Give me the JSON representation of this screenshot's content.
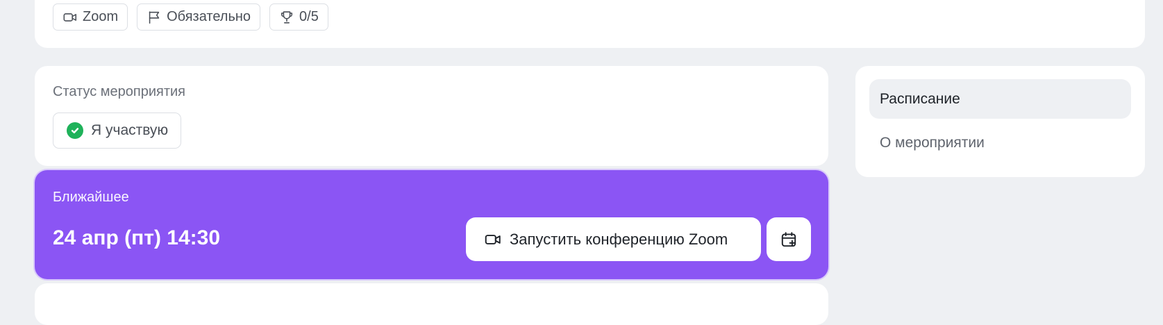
{
  "tags": [
    {
      "icon": "video-camera-icon",
      "label": "Zoom"
    },
    {
      "icon": "flag-icon",
      "label": "Обязательно"
    },
    {
      "icon": "trophy-icon",
      "label": "0/5"
    }
  ],
  "status": {
    "title": "Статус мероприятия",
    "value": "Я участвую",
    "icon": "check-circle-icon",
    "color": "#1fb25a"
  },
  "next_event": {
    "title": "Ближайшее",
    "datetime": "24 апр (пт) 14:30",
    "launch_button": "Запустить конференцию Zoom",
    "calendar_icon": "calendar-plus-icon",
    "background": "#8b55f4"
  },
  "side_nav": {
    "items": [
      {
        "label": "Расписание",
        "active": true
      },
      {
        "label": "О мероприятии",
        "active": false
      }
    ]
  }
}
